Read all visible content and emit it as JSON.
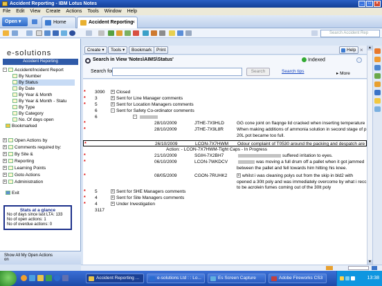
{
  "window": {
    "title": "Accident Reporting - IBM Lotus Notes"
  },
  "menu": [
    "File",
    "Edit",
    "View",
    "Create",
    "Actions",
    "Tools",
    "Window",
    "Help"
  ],
  "tabs": {
    "open": "Open",
    "home": "Home",
    "active": "Accident Reporting"
  },
  "toolbar": {
    "search_placeholder": "Search Accident Rep"
  },
  "nav": {
    "brand": "e-solutions",
    "brandbar": "Accident Reporting",
    "items": [
      {
        "label": "Accident/Incident Report",
        "indent": 0
      },
      {
        "label": "By Number",
        "indent": 1
      },
      {
        "label": "By Status",
        "indent": 1,
        "selected": true
      },
      {
        "label": "By Date",
        "indent": 1
      },
      {
        "label": "By Year & Month",
        "indent": 1
      },
      {
        "label": "By Year & Month - Statu",
        "indent": 1
      },
      {
        "label": "By Type",
        "indent": 1
      },
      {
        "label": "By Category",
        "indent": 1
      },
      {
        "label": "No. Of days open",
        "indent": 1
      },
      {
        "label": "Bookmarked",
        "indent": 0
      }
    ],
    "sections": [
      {
        "label": "Open Actions by"
      },
      {
        "label": "Comments required by:"
      },
      {
        "label": "By Site &"
      },
      {
        "label": "Reporting"
      },
      {
        "label": "Learning Points"
      },
      {
        "label": "Goto Actions"
      },
      {
        "label": "Administration"
      }
    ],
    "exit": "Exit",
    "stats": {
      "title": "Stats at a glance",
      "line1": "No of days since last LTA: 133",
      "line2": "No of open actions: 1",
      "line3": "No of overdue actions: 0"
    },
    "bottom": "Show All My Open Actions",
    "bottom2": "on"
  },
  "actionbar": {
    "create": "Create",
    "tools": "Tools",
    "bookmark": "Bookmark",
    "print": "Print",
    "help": "Help"
  },
  "search": {
    "title": "Search in View 'Notes\\AIMS\\Status'",
    "label": "Search for",
    "button": "Search",
    "tips": "Search tips",
    "indexed": "Indexed",
    "more": "More"
  },
  "view": {
    "rows": [
      {
        "star": true,
        "num": "3090",
        "cat": "Closed"
      },
      {
        "star": true,
        "num": "3",
        "cat": "Sent for Line Manager comments"
      },
      {
        "star": true,
        "num": "5",
        "cat": "Sent for Location Managers comments"
      },
      {
        "star": false,
        "num": "6",
        "cat": "Sent for Safety Co-ordinator comments"
      },
      {
        "star": false,
        "num": "6",
        "cat": ""
      }
    ],
    "docs": [
      {
        "date": "28/10/2009",
        "id": "JTHE-7X9HLD",
        "desc": "GG cone joint on flaqnge lid cracked when inserting temperature"
      },
      {
        "date": "28/10/2009",
        "id": "JTHE-7X9L8R",
        "desc": "When making additions of ammonia solution in second stage of p",
        "desc2": "20L pot became too full."
      },
      {
        "date": "26/10/2009",
        "id": "LCON-7X7HWM",
        "desc": "Odour complaint of T0530 around the packing and despatch are"
      },
      {
        "date": "21/10/2009",
        "id": "SGIH-7X2BH7",
        "desc": "suffered irritation to eyes."
      },
      {
        "date": "06/10/2009",
        "id": "LCON-7WKDCV",
        "desc": "was moving a full drum off a pallet when it got jammed",
        "desc2": "between the pallet and fell towards him hitting his knee."
      },
      {
        "date": "08/05/2009",
        "id": "CGON-7RUHK2",
        "desc": "whilst i was cleaning polys out from the skip in bld2 with",
        "desc2": "opened a 30lt poly and was immediately overcome by what i recc",
        "desc3": "to be acrolein fumes coming out of the 30lt poly"
      }
    ],
    "action_line": "Action: - LCON-7X7HWM-Tight Caps - In Progress",
    "tail": [
      {
        "star": true,
        "num": "5",
        "cat": "Sent for SHE Managers comments"
      },
      {
        "star": true,
        "num": "4",
        "cat": "Sent for Site Managers comments"
      },
      {
        "star": true,
        "num": "4",
        "cat": "Under Investigation"
      },
      {
        "star": false,
        "num": "3117",
        "cat": ""
      }
    ]
  },
  "taskbar": {
    "tasks": [
      "Accident Reporting ...",
      "e-solutions Ltd : : Lo...",
      "Es Screen Capture",
      "Adobe Fireworks CS3"
    ],
    "time": "13:38"
  }
}
